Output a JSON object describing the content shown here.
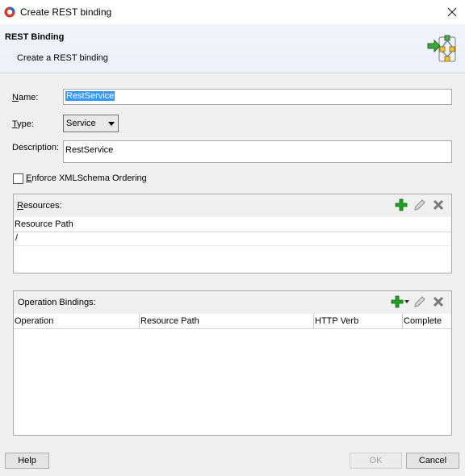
{
  "window": {
    "title": "Create REST binding"
  },
  "banner": {
    "title": "REST Binding",
    "subtitle": "Create a REST binding"
  },
  "form": {
    "name_label": "Name:",
    "name_value": "RestService",
    "type_label": "Type:",
    "type_value": "Service",
    "description_label": "Description:",
    "description_value": "RestService",
    "enforce_label": "Enforce XMLSchema Ordering",
    "enforce_checked": false
  },
  "resources": {
    "title": "Resources:",
    "columns": [
      "Resource Path"
    ],
    "rows": [
      "/"
    ]
  },
  "operations": {
    "title": "Operation Bindings:",
    "columns": [
      "Operation",
      "Resource Path",
      "HTTP Verb",
      "Complete"
    ],
    "rows": []
  },
  "buttons": {
    "help": "Help",
    "ok": "OK",
    "cancel": "Cancel"
  },
  "icons": {
    "add": "add-icon",
    "edit": "edit-pencil-icon",
    "delete": "delete-x-icon",
    "add_color": "#1fa31f"
  }
}
